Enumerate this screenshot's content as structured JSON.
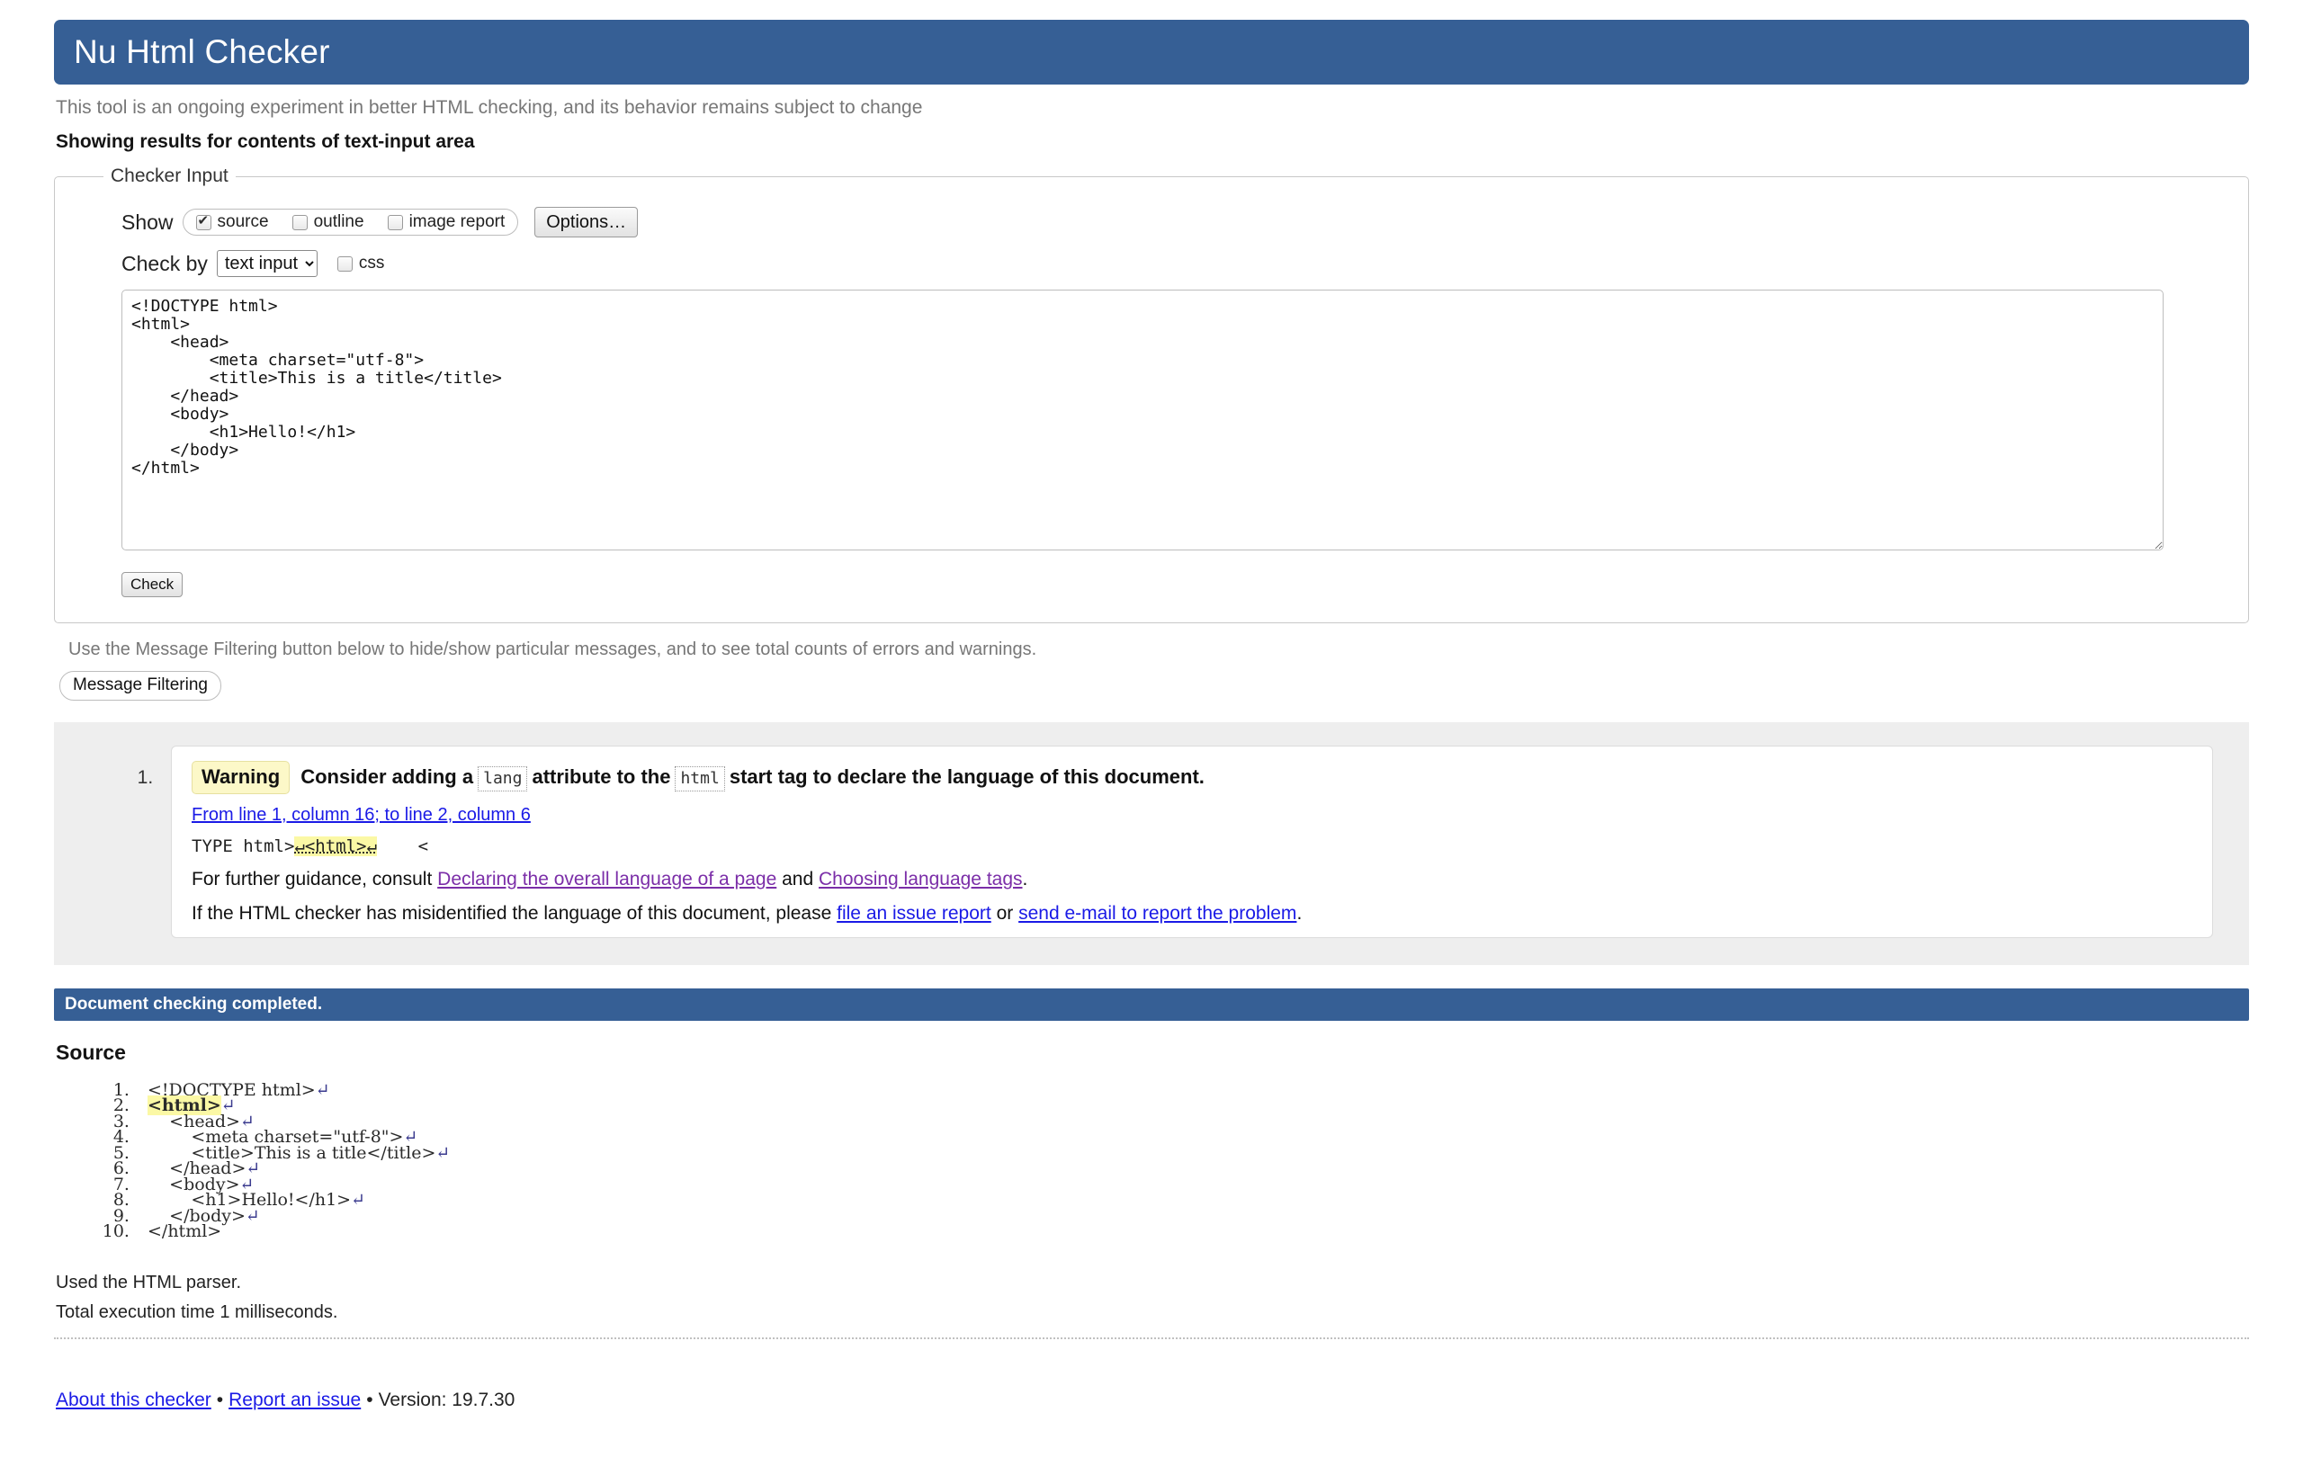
{
  "header": {
    "title": "Nu Html Checker",
    "banner_color": "#365f95"
  },
  "tagline": "This tool is an ongoing experiment in better HTML checking, and its behavior remains subject to change",
  "results_heading": "Showing results for contents of text-input area",
  "checker_input": {
    "legend": "Checker Input",
    "show_label": "Show",
    "show_options": [
      {
        "label": "source",
        "checked": true
      },
      {
        "label": "outline",
        "checked": false
      },
      {
        "label": "image report",
        "checked": false
      }
    ],
    "options_button": "Options…",
    "checkby_label": "Check by",
    "checkby_value": "text input",
    "checkby_options": [
      "text input"
    ],
    "css_label": "css",
    "css_checked": false,
    "textarea_value": "<!DOCTYPE html>\n<html>\n    <head>\n        <meta charset=\"utf-8\">\n        <title>This is a title</title>\n    </head>\n    <body>\n        <h1>Hello!</h1>\n    </body>\n</html>",
    "check_button": "Check"
  },
  "filtering": {
    "note": "Use the Message Filtering button below to hide/show particular messages, and to see total counts of errors and warnings.",
    "button": "Message Filtering"
  },
  "messages": [
    {
      "badge": "Warning",
      "headline_part1": "Consider adding a",
      "code1": "lang",
      "headline_part2": "attribute to the",
      "code2": "html",
      "headline_part3": "start tag to declare the language of this document.",
      "location": "From line 1, column 16; to line 2, column 6",
      "extract_before": "TYPE html>",
      "extract_highlight": "↵<html>↵",
      "extract_after": "    <",
      "guidance_prefix": "For further guidance, consult",
      "guidance_link1": "Declaring the overall language of a page",
      "guidance_and": "and",
      "guidance_link2": "Choosing language tags",
      "guidance_suffix": ".",
      "report_prefix": "If the HTML checker has misidentified the language of this document, please",
      "report_link1": "file an issue report",
      "report_or": "or",
      "report_link2": "send e-mail to report the problem",
      "report_suffix": "."
    }
  ],
  "completed_bar": "Document checking completed.",
  "source": {
    "heading": "Source",
    "lines": [
      {
        "text": "<!DOCTYPE html>",
        "cr": true,
        "highlight": false
      },
      {
        "text": "<html>",
        "cr": true,
        "highlight": true
      },
      {
        "text": "    <head>",
        "cr": true,
        "highlight": false
      },
      {
        "text": "        <meta charset=\"utf-8\">",
        "cr": true,
        "highlight": false
      },
      {
        "text": "        <title>This is a title</title>",
        "cr": true,
        "highlight": false
      },
      {
        "text": "    </head>",
        "cr": true,
        "highlight": false
      },
      {
        "text": "    <body>",
        "cr": true,
        "highlight": false
      },
      {
        "text": "        <h1>Hello!</h1>",
        "cr": true,
        "highlight": false
      },
      {
        "text": "    </body>",
        "cr": true,
        "highlight": false
      },
      {
        "text": "</html>",
        "cr": false,
        "highlight": false
      }
    ]
  },
  "parser_note": "Used the HTML parser.",
  "exec_note": "Total execution time 1 milliseconds.",
  "footer": {
    "about_link": "About this checker",
    "report_link": "Report an issue",
    "version": "Version: 19.7.30",
    "separator": "•"
  }
}
